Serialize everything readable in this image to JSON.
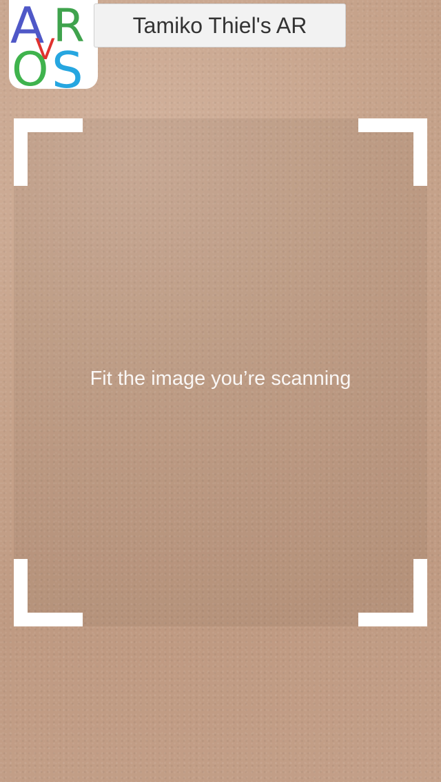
{
  "app": {
    "logo_letters": [
      "A",
      "R",
      "V",
      "O",
      "S"
    ],
    "logo_colors": {
      "A": "#4f58c7",
      "R": "#3fa34d",
      "V": "#e0322f",
      "O": "#3fb34d",
      "S": "#26a6e0"
    },
    "title": "Tamiko Thiel's AR"
  },
  "scanner": {
    "hint": "Fit the image you’re scanning",
    "frame_color": "#ffffff"
  }
}
